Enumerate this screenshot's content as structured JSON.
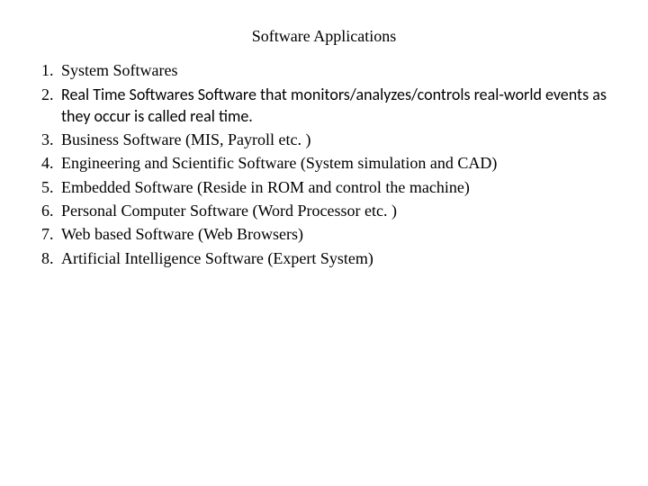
{
  "title": "Software Applications",
  "items": [
    {
      "text": "System Softwares"
    },
    {
      "text": "Real Time Softwares Software that monitors/analyzes/controls real-world events as they occur is called real time.",
      "alt_font": true
    },
    {
      "text": "Business Software (MIS, Payroll etc. )"
    },
    {
      "text": "Engineering and Scientific Software (System simulation and CAD)"
    },
    {
      "text": "Embedded Software (Reside in ROM and control the machine)"
    },
    {
      "text": "Personal Computer Software (Word Processor etc. )"
    },
    {
      "text": "Web based Software (Web Browsers)"
    },
    {
      "text": "Artificial Intelligence Software (Expert System)"
    }
  ]
}
